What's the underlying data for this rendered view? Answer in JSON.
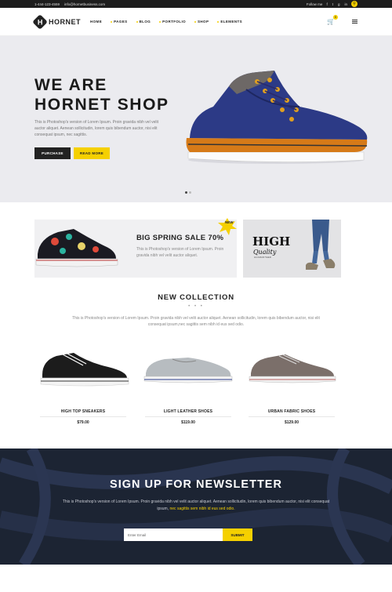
{
  "topbar": {
    "phone": "1-444-123-4559",
    "email": "info@hornetbusiness.com",
    "follow_label": "Follow me",
    "social": [
      "f",
      "t",
      "g",
      "in"
    ]
  },
  "header": {
    "logo_text": "HORNET",
    "logo_glyph": "H",
    "nav": [
      "HOME",
      "PAGES",
      "BLOG",
      "PORTFOLIO",
      "SHOP",
      "ELEMENTS"
    ],
    "cart_count": "0"
  },
  "hero": {
    "title_line1": "WE ARE",
    "title_line2": "HORNET SHOP",
    "text": "This is Photoshop's version of Lorem Ipsum. Proin gravida nibh vel velit auctor aliquet. Aenean sollicitudin, lorem quis bibendum auctor, nisi elit consequat ipsum, nec sagittis.",
    "btn_primary": "PURCHASE",
    "btn_secondary": "READ MORE"
  },
  "promo": {
    "title": "BIG SPRING SALE 70%",
    "text": "This is Photoshop's version of Lorem Ipsum. Proin gravida nibh vel velit auctor aliquet.",
    "badge": "NEW",
    "hq_big": "HIGH",
    "hq_small": "Quality",
    "hq_tiny": "GUARANTEED"
  },
  "collection": {
    "title": "NEW COLLECTION",
    "dots": "• • •",
    "text": "This is Photoshop's version of Lorem Ipsum. Proin gravida nibh vel velit auctor aliquet. Aenean sollicitudin, lorem quis bibendum auctor, nisi elit consequat ipsum,nec sagittis sem nibh id eus sed odio.",
    "products": [
      {
        "name": "HIGH TOP SNEAKERS",
        "price": "$79.00"
      },
      {
        "name": "LIGHT LEATHER SHOES",
        "price": "$119.00"
      },
      {
        "name": "URBAN FABRIC SHOES",
        "price": "$129.00"
      }
    ]
  },
  "newsletter": {
    "title": "SIGN UP FOR NEWSLETTER",
    "text": "This is Photoshop's version of Lorem Ipsum. Proin gravida nibh vel velit auctor aliquet. Aenean sollicitudin, lorem quis bibendum auctor, nisi elit consequat ipsum,",
    "text_highlight": "nec sagittis sem nibh id eus sed odio.",
    "placeholder": "Enter Email",
    "button": "SUBMIT"
  },
  "colors": {
    "accent": "#f5d000",
    "dark": "#222222",
    "hero_bg": "#ebebef",
    "newsletter_bg": "#1f2737"
  }
}
